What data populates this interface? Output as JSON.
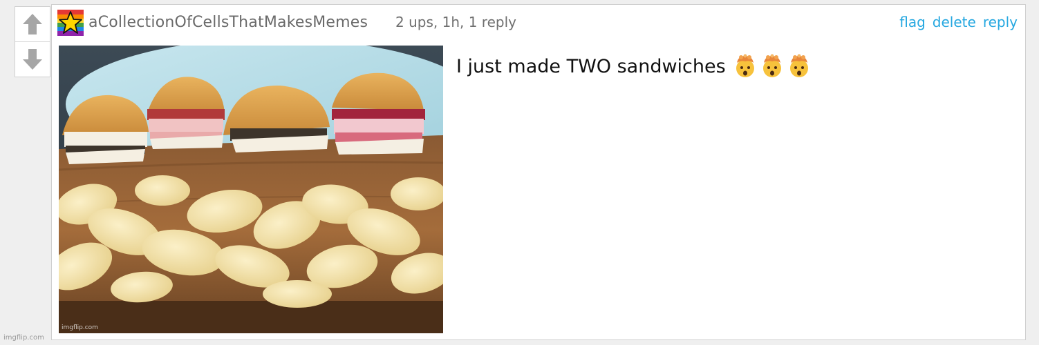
{
  "comment": {
    "username": "aCollectionOfCellsThatMakesMemes",
    "meta": "2 ups, 1h, 1 reply",
    "actions": {
      "flag": "flag",
      "delete": "delete",
      "reply": "reply"
    },
    "text": "I just made TWO sandwiches",
    "emoji_icon": "exploding-head-emoji",
    "emoji_count": 3,
    "image_watermark": "imgflip.com"
  },
  "vote": {
    "up_icon": "arrow-up-icon",
    "down_icon": "arrow-down-icon"
  },
  "footer": {
    "watermark": "imgflip.com"
  },
  "colors": {
    "link": "#24a7e0",
    "meta_text": "#6f6f6f",
    "arrow": "#a6a6a6",
    "border": "#cfcfcf",
    "background": "#efefef"
  }
}
